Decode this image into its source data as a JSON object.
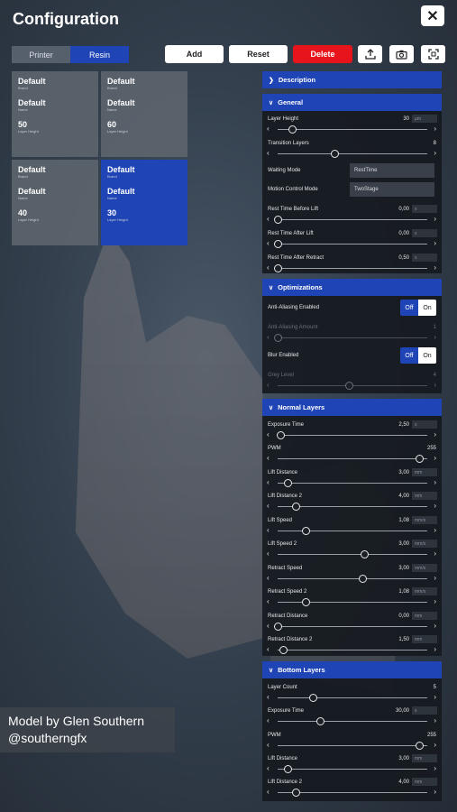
{
  "header": {
    "title": "Configuration",
    "close_icon": "close-icon"
  },
  "mode_tabs": [
    {
      "label": "Printer",
      "active": false
    },
    {
      "label": "Resin",
      "active": true
    }
  ],
  "toolbar": {
    "add_label": "Add",
    "reset_label": "Reset",
    "delete_label": "Delete",
    "icons": [
      "upload-icon",
      "camera-icon",
      "capture-icon"
    ],
    "delete_color": "#e8141c"
  },
  "profiles": [
    {
      "brand": "Default",
      "brand_label": "Brand",
      "name": "Default",
      "name_label": "Name",
      "layer_height": "50",
      "layer_height_label": "Layer Height",
      "selected": false
    },
    {
      "brand": "Default",
      "brand_label": "Brand",
      "name": "Default",
      "name_label": "Name",
      "layer_height": "60",
      "layer_height_label": "Layer Height",
      "selected": false
    },
    {
      "brand": "Default",
      "brand_label": "Brand",
      "name": "Default",
      "name_label": "Name",
      "layer_height": "40",
      "layer_height_label": "Layer Height",
      "selected": false
    },
    {
      "brand": "Default",
      "brand_label": "Brand",
      "name": "Default",
      "name_label": "Name",
      "layer_height": "30",
      "layer_height_label": "Layer Height",
      "selected": true
    }
  ],
  "sections": {
    "description": {
      "title": "Description"
    },
    "general": {
      "title": "General",
      "layer_height": {
        "label": "Layer Height",
        "value": "30",
        "unit": "µm",
        "level": 0.1
      },
      "transition_layers": {
        "label": "Transition Layers",
        "value": "8",
        "level": 0.4
      },
      "waiting_mode": {
        "label": "Waiting Mode",
        "value": "RestTime"
      },
      "motion_mode": {
        "label": "Motion Control Mode",
        "value": "TwoStage"
      },
      "rest_before_lift": {
        "label": "Rest Time Before Lift",
        "value": "0,00",
        "unit": "s",
        "level": 0
      },
      "rest_after_lift": {
        "label": "Rest Time After Lift",
        "value": "0,00",
        "unit": "s",
        "level": 0
      },
      "rest_after_retract": {
        "label": "Rest Time After Retract",
        "value": "0,50",
        "unit": "s",
        "level": 0
      }
    },
    "optimizations": {
      "title": "Optimizations",
      "aa_enabled": {
        "label": "Anti-Aliasing Enabled",
        "off": "Off",
        "on": "On"
      },
      "aa_amount": {
        "label": "Anti-Aliasing Amount",
        "value": "1",
        "level": 0
      },
      "blur_enabled": {
        "label": "Blur Enabled",
        "off": "Off",
        "on": "On"
      },
      "grey_level": {
        "label": "Grey Level",
        "value": "4",
        "level": 0.5
      }
    },
    "normal_layers": {
      "title": "Normal Layers",
      "exposure": {
        "label": "Exposure Time",
        "value": "2,50",
        "unit": "s",
        "level": 0.02
      },
      "pwm": {
        "label": "PWM",
        "value": "255",
        "level": 1
      },
      "lift_distance": {
        "label": "Lift Distance",
        "value": "3,00",
        "unit": "mm",
        "level": 0.07
      },
      "lift_distance2": {
        "label": "Lift Distance 2",
        "value": "4,00",
        "unit": "mm",
        "level": 0.13
      },
      "lift_speed": {
        "label": "Lift Speed",
        "value": "1,08",
        "unit": "mm/s",
        "level": 0.2
      },
      "lift_speed2": {
        "label": "Lift Speed 2",
        "value": "3,00",
        "unit": "mm/s",
        "level": 0.61
      },
      "retract_speed": {
        "label": "Retract Speed",
        "value": "3,00",
        "unit": "mm/s",
        "level": 0.6
      },
      "retract_speed2": {
        "label": "Retract Speed 2",
        "value": "1,08",
        "unit": "mm/s",
        "level": 0.2
      },
      "retract_distance": {
        "label": "Retract Distance",
        "value": "0,00",
        "unit": "mm",
        "level": 0
      },
      "retract_distance2": {
        "label": "Retract Distance 2",
        "value": "1,50",
        "unit": "mm",
        "level": 0.04
      }
    },
    "bottom_layers": {
      "title": "Bottom Layers",
      "layer_count": {
        "label": "Layer Count",
        "value": "5",
        "level": 0.25
      },
      "exposure": {
        "label": "Exposure Time",
        "value": "30,00",
        "unit": "s",
        "level": 0.3
      },
      "pwm": {
        "label": "PWM",
        "value": "255",
        "level": 1
      },
      "lift_distance": {
        "label": "Lift Distance",
        "value": "3,00",
        "unit": "mm",
        "level": 0.07
      },
      "lift_distance2": {
        "label": "Lift Distance 2",
        "value": "4,00",
        "unit": "mm",
        "level": 0.13
      }
    }
  },
  "credit": {
    "line1": "Model by Glen Southern",
    "line2": "@southerngfx"
  },
  "colors": {
    "accent": "#1f44b6",
    "panel": "#161a20"
  }
}
